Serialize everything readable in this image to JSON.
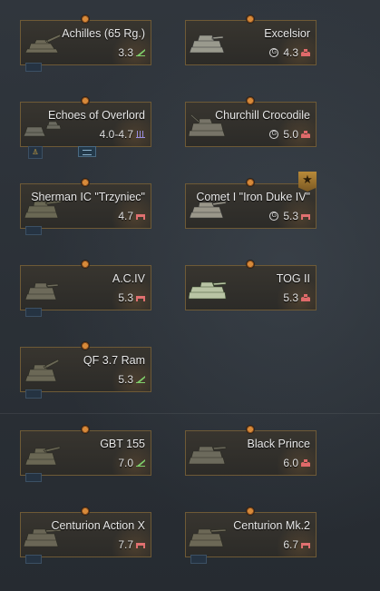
{
  "vehicles": [
    {
      "name": "Achilles (65 Rg.)",
      "br": "3.3",
      "premium": false,
      "rank_color": "#7fcf6b",
      "rank_shape": "stripe"
    },
    {
      "name": "Excelsior",
      "br": "4.3",
      "premium": true,
      "rank_color": "#e06a6a",
      "rank_shape": "dots"
    },
    {
      "name": "Echoes of Overlord",
      "br": "4.0-4.7",
      "premium": false,
      "rank_color": "#9a8ee0",
      "rank_shape": "bars"
    },
    {
      "name": "Churchill Crocodile",
      "br": "5.0",
      "premium": true,
      "rank_color": "#e06a6a",
      "rank_shape": "dots"
    },
    {
      "name": "Sherman IC \"Trzyniec\"",
      "br": "4.7",
      "premium": false,
      "rank_color": "#e07070",
      "rank_shape": "flag"
    },
    {
      "name": "Comet I \"Iron Duke IV\"",
      "br": "5.3",
      "premium": true,
      "rank_color": "#e07070",
      "rank_shape": "flag"
    },
    {
      "name": "A.C.IV",
      "br": "5.3",
      "premium": false,
      "rank_color": "#e07070",
      "rank_shape": "flag"
    },
    {
      "name": "TOG II",
      "br": "5.3",
      "premium": false,
      "rank_color": "#e06a6a",
      "rank_shape": "dots"
    },
    {
      "name": "QF 3.7 Ram",
      "br": "5.3",
      "premium": false,
      "rank_color": "#7fcf6b",
      "rank_shape": "stripe"
    },
    {
      "name": "GBT 155",
      "br": "7.0",
      "premium": false,
      "rank_color": "#7fcf6b",
      "rank_shape": "stripe"
    },
    {
      "name": "Black Prince",
      "br": "6.0",
      "premium": false,
      "rank_color": "#e06a6a",
      "rank_shape": "dots"
    },
    {
      "name": "Centurion Action X",
      "br": "7.7",
      "premium": false,
      "rank_color": "#e07070",
      "rank_shape": "flag"
    },
    {
      "name": "Centurion Mk.2",
      "br": "6.7",
      "premium": false,
      "rank_color": "#e07070",
      "rank_shape": "flag"
    }
  ],
  "icons": {
    "premium": "G",
    "crew": "♙",
    "star": "★"
  },
  "colors": {
    "card_border": "#6e5a36",
    "research_dot": "#d78a3a"
  }
}
